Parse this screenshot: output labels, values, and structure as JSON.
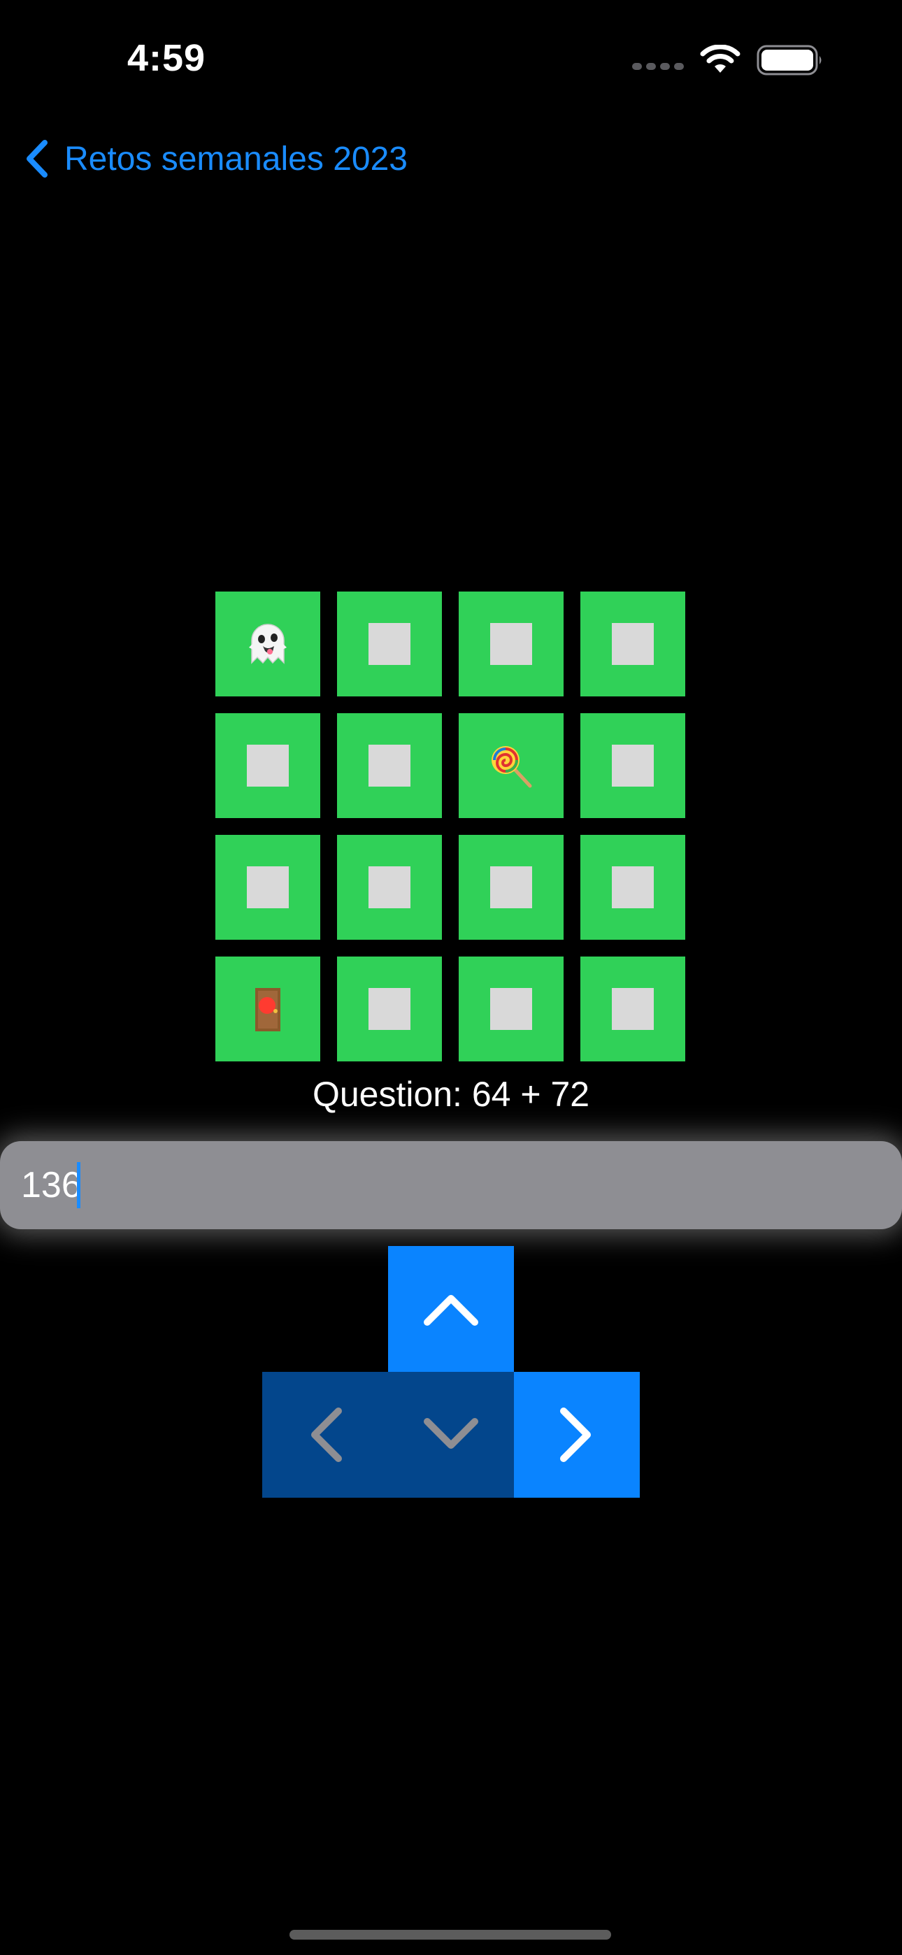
{
  "status_bar": {
    "time": "4:59",
    "icons": [
      "cellular-signal-icon",
      "wifi-icon",
      "battery-icon"
    ]
  },
  "nav": {
    "back_label": "Retos semanales 2023",
    "back_icon": "chevron-left-icon",
    "accent_color": "#1a8cff"
  },
  "board": {
    "rows": 4,
    "cols": 4,
    "tile_color": "#30d158",
    "empty_marker_color": "#d9d9d9",
    "cells": [
      [
        "ghost",
        "empty",
        "empty",
        "empty"
      ],
      [
        "empty",
        "empty",
        "lollipop",
        "empty"
      ],
      [
        "empty",
        "empty",
        "empty",
        "empty"
      ],
      [
        "door",
        "empty",
        "empty",
        "empty"
      ]
    ]
  },
  "question": {
    "text": "Question: 64 + 72"
  },
  "answer": {
    "value": "136"
  },
  "controls": {
    "up": {
      "icon": "chevron-up-icon",
      "enabled": true,
      "color": "#0a84ff"
    },
    "left": {
      "icon": "chevron-left-icon",
      "enabled": false,
      "color": "#03468c"
    },
    "down": {
      "icon": "chevron-down-icon",
      "enabled": false,
      "color": "#03468c"
    },
    "right": {
      "icon": "chevron-right-icon",
      "enabled": true,
      "color": "#0a84ff"
    }
  }
}
